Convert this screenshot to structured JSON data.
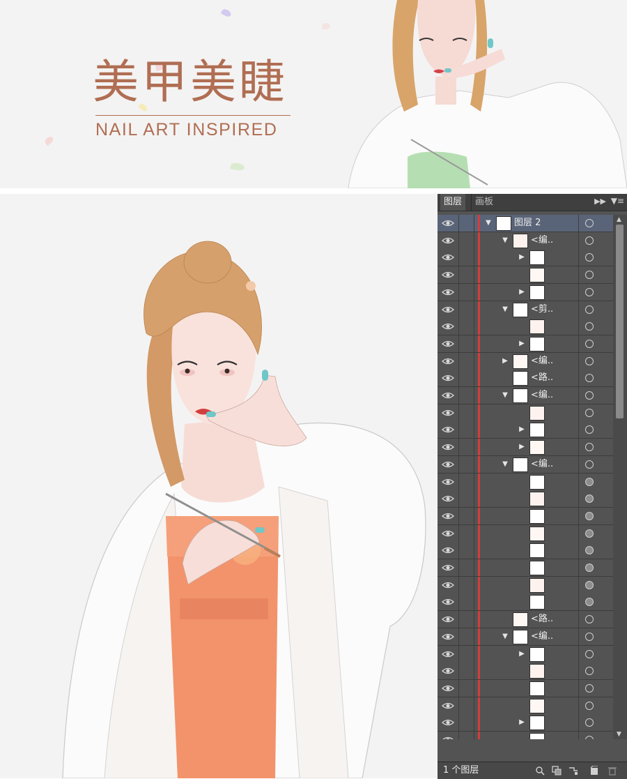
{
  "banner": {
    "title": "美甲美睫",
    "subtitle": "NAIL ART INSPIRED"
  },
  "colors": {
    "accent": "#b06e53",
    "panel_bg": "#535353",
    "panel_header": "#3f3f3f",
    "layer_color": "#d23d3d",
    "selected_row": "#5a6478"
  },
  "layers_panel": {
    "tabs": [
      {
        "label": "图层"
      },
      {
        "label": "画板"
      }
    ],
    "collapse_icon": "double-arrow-icon",
    "menu_icon": "panel-menu-icon",
    "rows": [
      {
        "indent": 0,
        "arrow": "down",
        "label": "图层 2",
        "selected": true
      },
      {
        "indent": 1,
        "arrow": "down",
        "label": "<编.."
      },
      {
        "indent": 2,
        "arrow": "right",
        "label": ""
      },
      {
        "indent": 2,
        "arrow": "",
        "label": ""
      },
      {
        "indent": 2,
        "arrow": "right",
        "label": ""
      },
      {
        "indent": 1,
        "arrow": "down",
        "label": "<剪.."
      },
      {
        "indent": 2,
        "arrow": "",
        "label": ""
      },
      {
        "indent": 2,
        "arrow": "right",
        "label": ""
      },
      {
        "indent": 1,
        "arrow": "right",
        "label": "<编.."
      },
      {
        "indent": 1,
        "arrow": "",
        "label": "<路.."
      },
      {
        "indent": 1,
        "arrow": "down",
        "label": "<编.."
      },
      {
        "indent": 2,
        "arrow": "",
        "label": ""
      },
      {
        "indent": 2,
        "arrow": "right",
        "label": ""
      },
      {
        "indent": 2,
        "arrow": "right",
        "label": ""
      },
      {
        "indent": 1,
        "arrow": "down",
        "label": "<编.."
      },
      {
        "indent": 2,
        "arrow": "",
        "label": "",
        "filled": true
      },
      {
        "indent": 2,
        "arrow": "",
        "label": "",
        "filled": true
      },
      {
        "indent": 2,
        "arrow": "",
        "label": "",
        "filled": true
      },
      {
        "indent": 2,
        "arrow": "",
        "label": "",
        "filled": true
      },
      {
        "indent": 2,
        "arrow": "",
        "label": "",
        "filled": true
      },
      {
        "indent": 2,
        "arrow": "",
        "label": "",
        "filled": true
      },
      {
        "indent": 2,
        "arrow": "",
        "label": "",
        "filled": true
      },
      {
        "indent": 2,
        "arrow": "",
        "label": "",
        "filled": true
      },
      {
        "indent": 1,
        "arrow": "",
        "label": "<路.."
      },
      {
        "indent": 1,
        "arrow": "down",
        "label": "<编.."
      },
      {
        "indent": 2,
        "arrow": "right",
        "label": ""
      },
      {
        "indent": 2,
        "arrow": "",
        "label": ""
      },
      {
        "indent": 2,
        "arrow": "",
        "label": ""
      },
      {
        "indent": 2,
        "arrow": "",
        "label": ""
      },
      {
        "indent": 2,
        "arrow": "right",
        "label": ""
      },
      {
        "indent": 2,
        "arrow": "",
        "label": ""
      },
      {
        "indent": 2,
        "arrow": "",
        "label": ""
      }
    ],
    "footer": {
      "layer_count": "1 个图层",
      "icons": [
        "locate-object-icon",
        "make-clip-mask-icon",
        "sublayer-icon",
        "new-layer-icon",
        "trash-icon"
      ]
    }
  }
}
